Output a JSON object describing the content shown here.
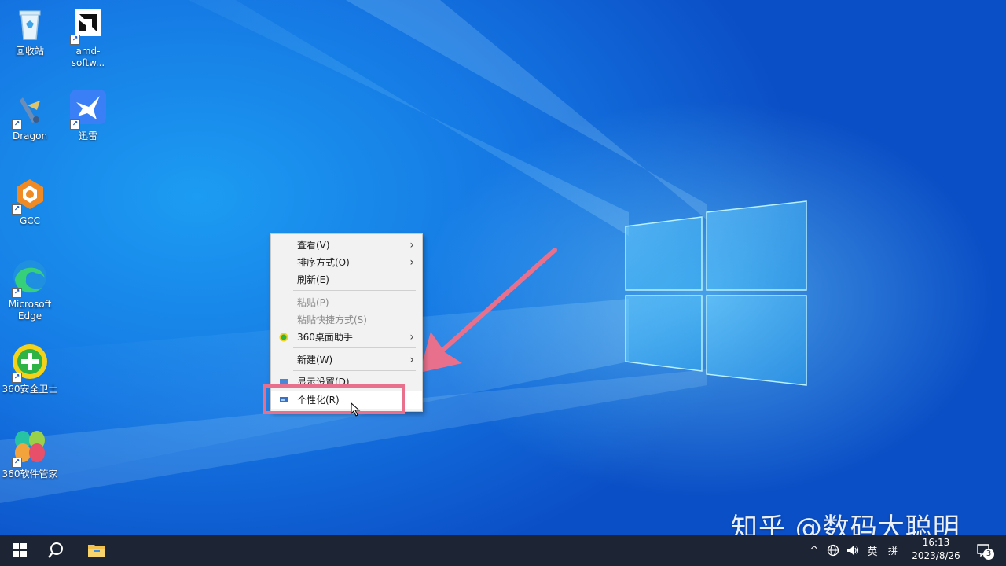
{
  "desktop_icons": {
    "recycle_bin": "回收站",
    "amd": "amd-softw...",
    "dragon": "Dragon",
    "xunlei": "迅雷",
    "gcc": "GCC",
    "edge_line1": "Microsoft",
    "edge_line2": "Edge",
    "safe360": "360安全卫士",
    "soft360": "360软件管家"
  },
  "context_menu": {
    "view": "查看(V)",
    "sort": "排序方式(O)",
    "refresh": "刷新(E)",
    "paste": "粘贴(P)",
    "paste_shortcut": "粘贴快捷方式(S)",
    "desktop_helper": "360桌面助手",
    "new": "新建(W)",
    "display_settings": "显示设置(D)",
    "personalize": "个性化(R)"
  },
  "watermark": "知乎 @数码大聪明",
  "taskbar": {
    "ime_lang": "英",
    "ime_mode": "拼",
    "time": "16:13",
    "date": "2023/8/26",
    "notification_count": "3"
  },
  "colors": {
    "highlight_border": "#e8708c",
    "arrow": "#e8708c",
    "taskbar": "#1d2433"
  }
}
